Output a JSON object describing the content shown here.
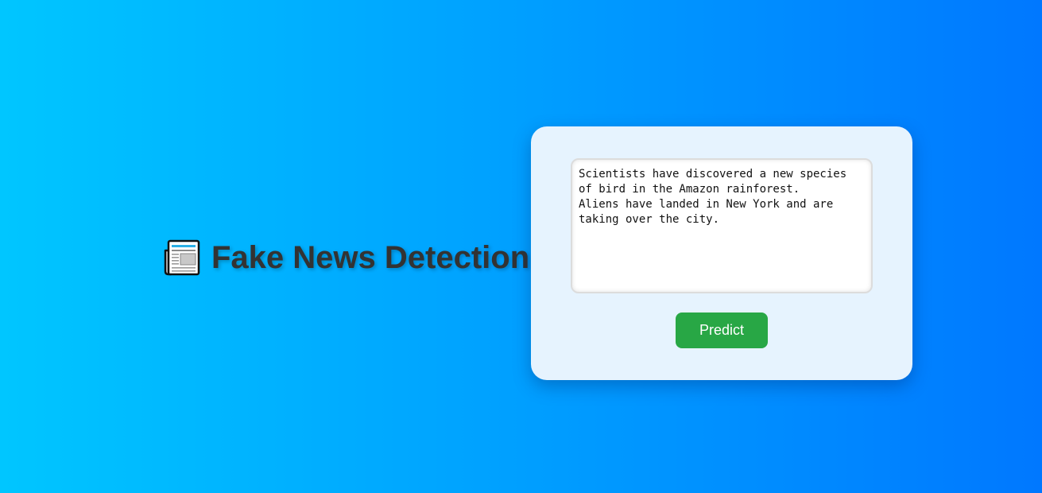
{
  "header": {
    "title": "Fake News Detection",
    "icon": "newspaper-icon"
  },
  "form": {
    "input_value": "Scientists have discovered a new species of bird in the Amazon rainforest.\nAliens have landed in New York and are taking over the city.",
    "predict_label": "Predict"
  },
  "colors": {
    "background_start": "#00c6ff",
    "background_end": "#0078ff",
    "card_background": "#e6f3fe",
    "button_background": "#28a745",
    "title_text": "#333333"
  }
}
